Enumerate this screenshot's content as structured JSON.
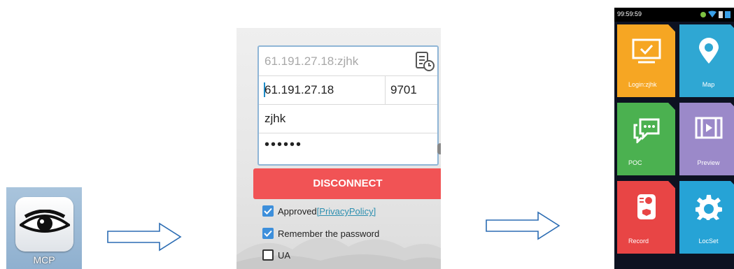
{
  "app_icon": {
    "label": "MCP",
    "icon": "eye-icon",
    "colors": {
      "bg": "#8fb0cf"
    }
  },
  "login": {
    "server_history_value": "61.191.27.18:zjhk",
    "ip_value": "61.191.27.18",
    "port_value": "9701",
    "username_value": "zjhk",
    "password_value": "••••••",
    "disconnect_label": "DISCONNECT",
    "approved_label": "Approved",
    "privacy_link": "[PrivacyPolicy]",
    "remember_label": "Remember the password",
    "ua_label": "UA",
    "colors": {
      "accent": "#f15355",
      "check": "#3d8fdb",
      "link": "#2d8fb0"
    }
  },
  "phone": {
    "time": "99:59:59",
    "tiles": [
      {
        "label": "Login:zjhk",
        "icon": "monitor-check-icon",
        "color": "#f6a623"
      },
      {
        "label": "Map",
        "icon": "map-pin-icon",
        "color": "#2fa7d3"
      },
      {
        "label": "POC",
        "icon": "chat-bubbles-icon",
        "color": "#4bb150"
      },
      {
        "label": "Preview",
        "icon": "film-play-icon",
        "color": "#9b89c9"
      },
      {
        "label": "Record",
        "icon": "camera-recorder-icon",
        "color": "#e84545"
      },
      {
        "label": "LocSet",
        "icon": "gear-icon",
        "color": "#26a3d6"
      }
    ]
  }
}
